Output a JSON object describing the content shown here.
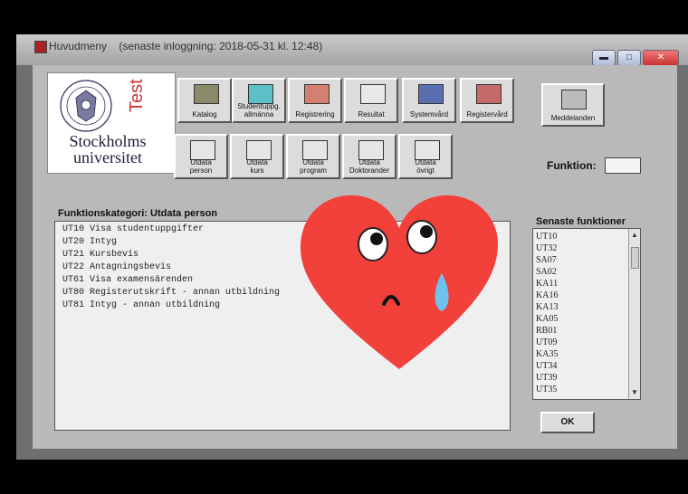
{
  "window": {
    "title": "Huvudmeny",
    "last_login": "(senaste inloggning:  2018-05-31  kl. 12:48)",
    "controls": [
      "minimize",
      "maximize",
      "close"
    ]
  },
  "logo": {
    "test": "Test",
    "name_line1": "Stockholms",
    "name_line2": "universitet"
  },
  "toolbar_row1": [
    {
      "label": "Katalog",
      "icon": "cabinet-icon"
    },
    {
      "label": "Studentuppg.\nallmänna",
      "icon": "student-card-icon"
    },
    {
      "label": "Registrering",
      "icon": "register-icon"
    },
    {
      "label": "Resultat",
      "icon": "results-icon"
    },
    {
      "label": "Systemvård",
      "icon": "tools-icon"
    },
    {
      "label": "Registervård",
      "icon": "register-tools-icon"
    }
  ],
  "toolbar_row2": [
    {
      "label": "Utdata\nperson",
      "icon": "printer-person-icon"
    },
    {
      "label": "Utdata\nkurs",
      "icon": "printer-kurs-icon"
    },
    {
      "label": "Utdata\nprogram",
      "icon": "printer-prog-icon"
    },
    {
      "label": "Utdata\nDoktorander",
      "icon": "printer-doctor-icon"
    },
    {
      "label": "Utdata\növrigt",
      "icon": "printer-other-icon"
    }
  ],
  "messages_button": "Meddelanden",
  "funktion": {
    "label": "Funktion:",
    "value": ""
  },
  "category": {
    "label": "Funktionskategori:  Utdata person",
    "items": [
      "UT10 Visa studentuppgifter",
      "UT20 Intyg",
      "UT21 Kursbevis",
      "UT22 Antagningsbevis",
      "UT61 Visa examensärenden",
      "UT80 Registerutskrift - annan utbildning",
      "UT81 Intyg - annan utbildning"
    ]
  },
  "recent": {
    "label": "Senaste funktioner",
    "items": [
      "UT10",
      "UT32",
      "SA07",
      "SA02",
      "KA11",
      "KA16",
      "KA13",
      "KA05",
      "RB01",
      "UT09",
      "KA35",
      "UT34",
      "UT39",
      "UT35"
    ]
  },
  "ok_button": "OK",
  "colors": {
    "heart": "#f2403a",
    "tear": "#6ec3ee"
  }
}
